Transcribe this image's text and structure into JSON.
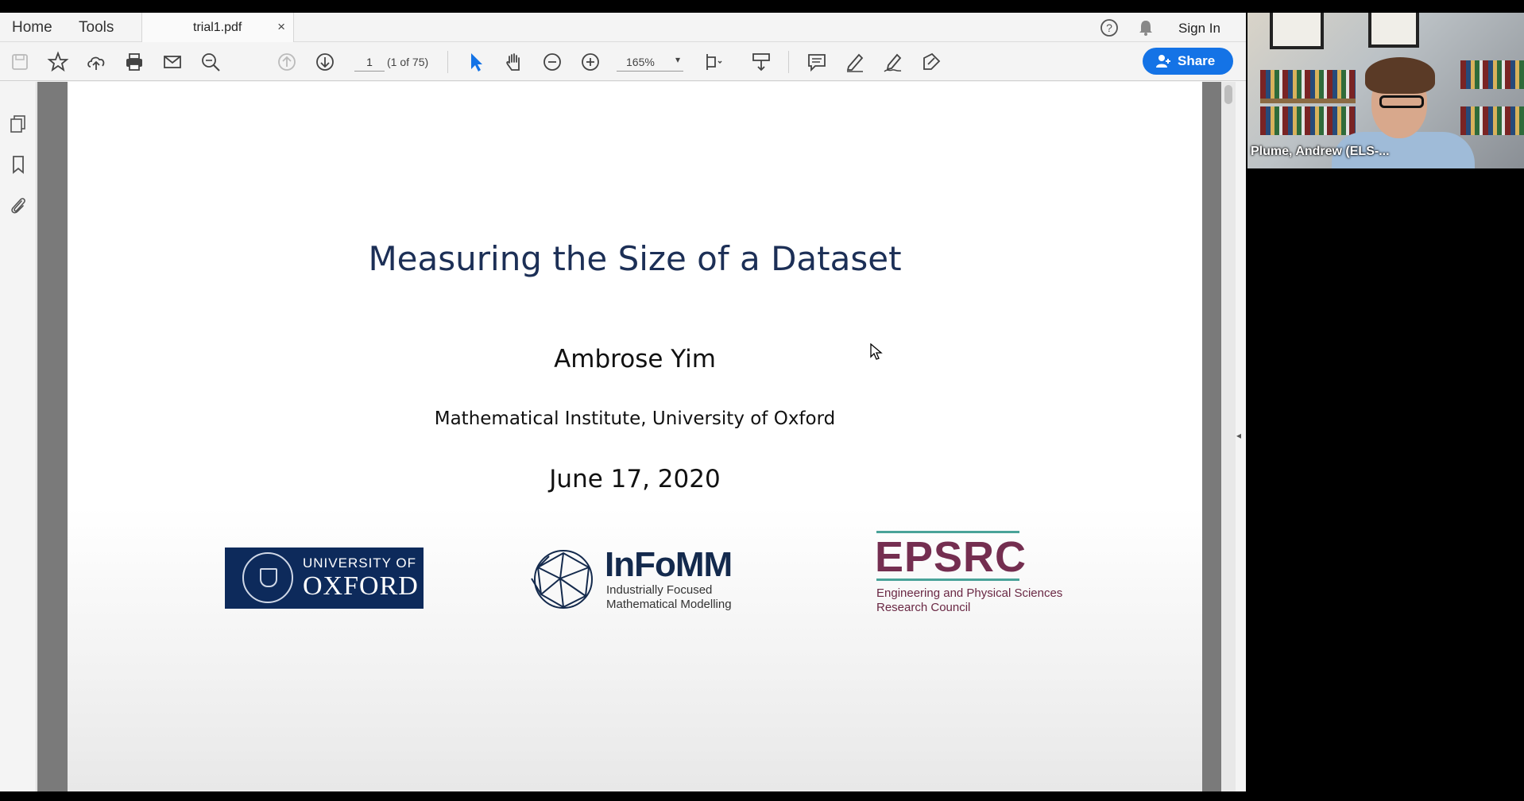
{
  "menubar": {
    "home_label": "Home",
    "tools_label": "Tools",
    "tab_name": "trial1.pdf",
    "tab_close": "×",
    "sign_in": "Sign In"
  },
  "toolbar": {
    "page_number": "1",
    "page_of": "(1 of 75)",
    "zoom": "165%",
    "share_label": "Share",
    "icons": [
      "save-icon",
      "bookmark-star-icon",
      "upload-cloud-icon",
      "print-icon",
      "email-icon",
      "zoom-search-icon",
      "prev-page-icon",
      "next-page-icon",
      "select-arrow-icon",
      "hand-tool-icon",
      "zoom-out-icon",
      "zoom-in-icon",
      "page-fit-icon",
      "scroll-mode-icon",
      "comment-icon",
      "highlight-pen-icon",
      "sign-icon",
      "edit-pdf-icon"
    ]
  },
  "colors": {
    "accent": "#1473e6",
    "title_color": "#1c2f56",
    "oxford_blue": "#0d2a5b",
    "epsrc_maroon": "#742e50",
    "epsrc_teal": "#4aa399"
  },
  "document": {
    "title": "Measuring the Size of a Dataset",
    "author": "Ambrose Yim",
    "institute": "Mathematical Institute, University of Oxford",
    "date": "June 17, 2020",
    "logos": {
      "oxford_line1": "UNIVERSITY OF",
      "oxford_line2": "OXFORD",
      "infomm_name": "InFoMM",
      "infomm_line1": "Industrially Focused",
      "infomm_line2": "Mathematical Modelling",
      "epsrc_name": "EPSRC",
      "epsrc_line1": "Engineering and Physical Sciences",
      "epsrc_line2": "Research Council"
    }
  },
  "video": {
    "participant_name": "Plume, Andrew (ELS-..."
  }
}
